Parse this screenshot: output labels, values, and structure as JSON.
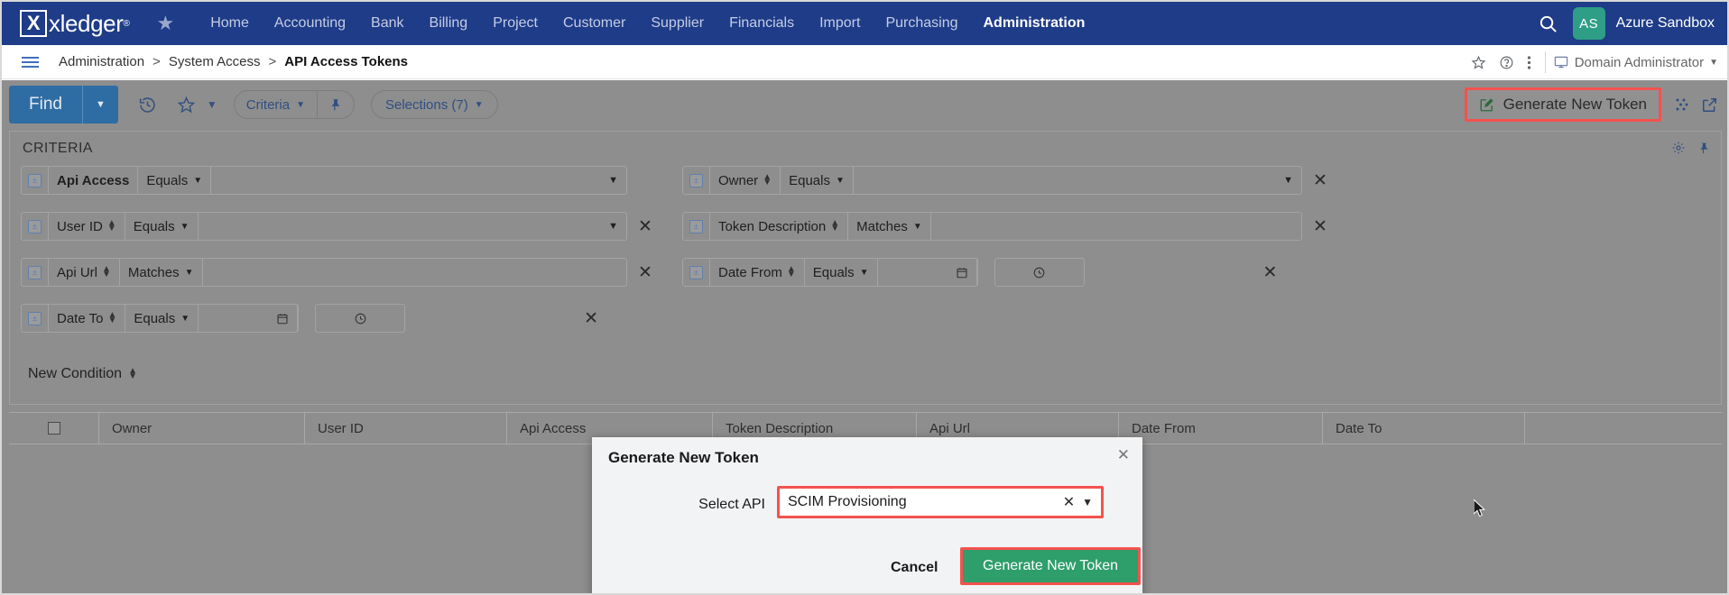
{
  "topnav": {
    "brand": "xledger",
    "brand_mark": "X",
    "favorites_icon": "star-icon",
    "items": [
      {
        "label": "Home",
        "active": false
      },
      {
        "label": "Accounting",
        "active": false
      },
      {
        "label": "Bank",
        "active": false
      },
      {
        "label": "Billing",
        "active": false
      },
      {
        "label": "Project",
        "active": false
      },
      {
        "label": "Customer",
        "active": false
      },
      {
        "label": "Supplier",
        "active": false
      },
      {
        "label": "Financials",
        "active": false
      },
      {
        "label": "Import",
        "active": false
      },
      {
        "label": "Purchasing",
        "active": false
      },
      {
        "label": "Administration",
        "active": true
      }
    ],
    "search_icon": "search-icon",
    "avatar_initials": "AS",
    "account_name": "Azure Sandbox",
    "brand_color": "#1f3c88",
    "avatar_color": "#2f9e86"
  },
  "breadcrumb": {
    "menu_icon": "hamburger-icon",
    "items": [
      "Administration",
      "System Access",
      "API Access Tokens"
    ],
    "separator": ">",
    "right_icons": [
      "star-outline-icon",
      "help-circle-icon",
      "kebab-menu-icon",
      "monitor-icon"
    ],
    "user_role": "Domain Administrator"
  },
  "toolbar": {
    "find_label": "Find",
    "find_caret_icon": "caret-down-icon",
    "history_icon": "history-icon",
    "favorite_icon": "star-outline-icon",
    "favorite_caret_icon": "chevron-down-icon",
    "criteria_label": "Criteria",
    "criteria_caret_icon": "chevron-down-icon",
    "pin_icon": "pin-icon",
    "selections_label": "Selections (7)",
    "selections_caret_icon": "chevron-down-icon",
    "generate_token_label": "Generate New Token",
    "generate_token_icon": "edit-square-icon",
    "more_dots_icon": "dots-icon",
    "popout_icon": "external-link-icon",
    "highlight_color": "#f4524d"
  },
  "criteria": {
    "title": "CRITERIA",
    "settings_icon": "gear-icon",
    "pin_icon": "pin-icon",
    "new_condition_label": "New Condition",
    "remove_icon": "close-x-icon",
    "rows": [
      {
        "checkbox_icon": "filter-toggle-icon",
        "field": "Api Access",
        "field_bold": true,
        "has_spinner": false,
        "operator": "Equals",
        "value": "",
        "value_type": "select",
        "removable": false
      },
      {
        "checkbox_icon": "filter-toggle-icon",
        "field": "User ID",
        "field_bold": false,
        "has_spinner": true,
        "operator": "Equals",
        "value": "",
        "value_type": "select",
        "removable": true
      },
      {
        "checkbox_icon": "filter-toggle-icon",
        "field": "Api Url",
        "field_bold": false,
        "has_spinner": true,
        "operator": "Matches",
        "value": "",
        "value_type": "text",
        "removable": true
      },
      {
        "checkbox_icon": "filter-toggle-icon",
        "field": "Date To",
        "field_bold": false,
        "has_spinner": true,
        "operator": "Equals",
        "value": "",
        "value_type": "datetime",
        "removable": true
      },
      {
        "checkbox_icon": "filter-toggle-icon",
        "field": "Owner",
        "field_bold": false,
        "has_spinner": true,
        "operator": "Equals",
        "value": "",
        "value_type": "select",
        "removable": true
      },
      {
        "checkbox_icon": "filter-toggle-icon",
        "field": "Token Description",
        "field_bold": false,
        "has_spinner": true,
        "operator": "Matches",
        "value": "",
        "value_type": "text",
        "removable": true
      },
      {
        "checkbox_icon": "filter-toggle-icon",
        "field": "Date From",
        "field_bold": false,
        "has_spinner": true,
        "operator": "Equals",
        "value": "",
        "value_type": "datetime",
        "removable": true
      }
    ],
    "date_icon": "calendar-icon",
    "time_icon": "clock-icon"
  },
  "table": {
    "select_all_icon": "checkbox-icon",
    "columns": [
      "Owner",
      "User ID",
      "Api Access",
      "Token Description",
      "Api Url",
      "Date From",
      "Date To"
    ],
    "rows": []
  },
  "modal": {
    "title": "Generate New Token",
    "close_icon": "close-x-icon",
    "field_label": "Select API",
    "field_value": "SCIM Provisioning",
    "field_clear_icon": "clear-x-icon",
    "field_caret_icon": "chevron-down-icon",
    "cancel_label": "Cancel",
    "submit_label": "Generate New Token",
    "submit_color": "#2e9e6b",
    "highlight_color": "#f4524d"
  }
}
